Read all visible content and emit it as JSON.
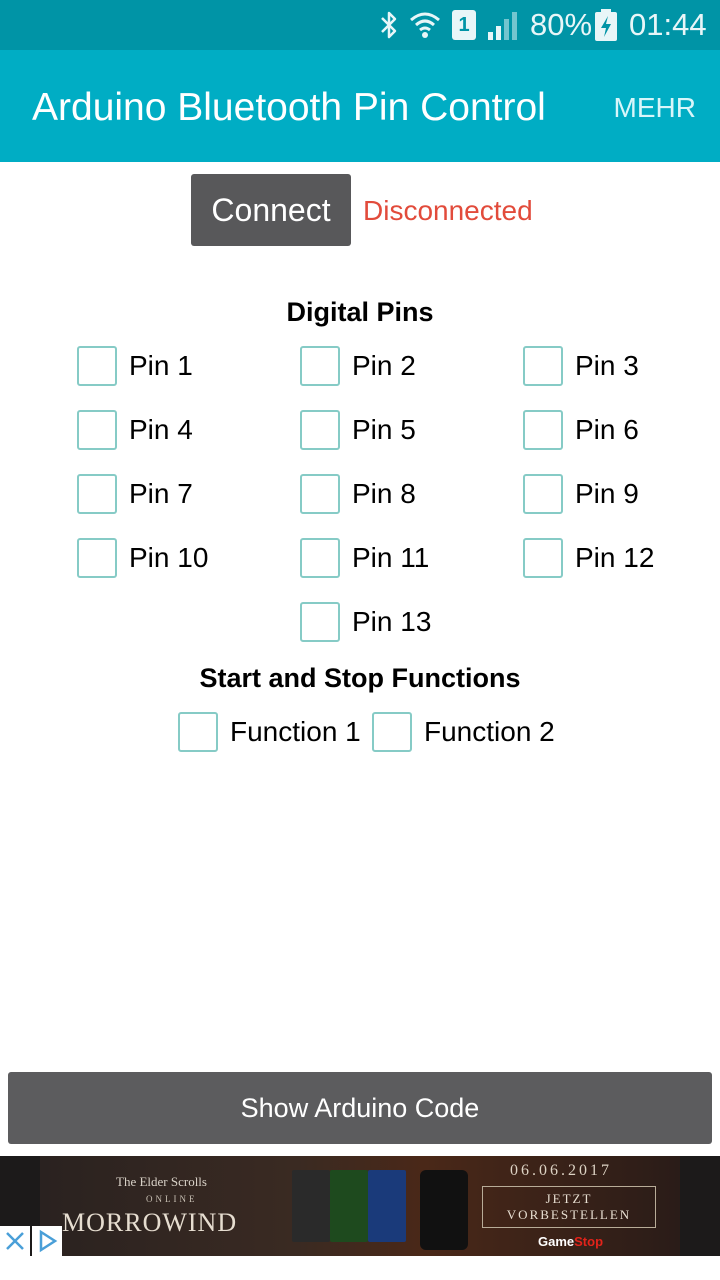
{
  "status_bar": {
    "sim_slot": "1",
    "battery": "80%",
    "time": "01:44",
    "icons": [
      "bluetooth-icon",
      "wifi-icon",
      "sim-icon",
      "signal-icon",
      "battery-charging-icon"
    ]
  },
  "app_bar": {
    "title": "Arduino Bluetooth Pin Control",
    "more_label": "MEHR"
  },
  "connection": {
    "connect_label": "Connect",
    "status_text": "Disconnected",
    "status_color": "#e24b3b"
  },
  "digital_pins": {
    "heading": "Digital Pins",
    "pins": [
      "Pin 1",
      "Pin 2",
      "Pin 3",
      "Pin 4",
      "Pin 5",
      "Pin 6",
      "Pin 7",
      "Pin 8",
      "Pin 9",
      "Pin 10",
      "Pin 11",
      "Pin 12",
      "Pin 13"
    ],
    "checked": [
      false,
      false,
      false,
      false,
      false,
      false,
      false,
      false,
      false,
      false,
      false,
      false,
      false
    ]
  },
  "functions": {
    "heading": "Start and Stop Functions",
    "items": [
      "Function 1",
      "Function 2"
    ],
    "checked": [
      false,
      false
    ]
  },
  "show_code_label": "Show Arduino Code",
  "ad": {
    "game_line1": "The Elder Scrolls",
    "game_line2": "ONLINE",
    "game_title": "MORROWIND",
    "date": "06.06.2017",
    "cta_line1": "JETZT",
    "cta_line2": "VORBESTELLEN",
    "sponsor_part1": "Game",
    "sponsor_part2": "Stop"
  },
  "colors": {
    "status_bar": "#0094a6",
    "app_bar": "#00adc4",
    "button": "#58585a",
    "checkbox_border": "#86cbc6"
  }
}
